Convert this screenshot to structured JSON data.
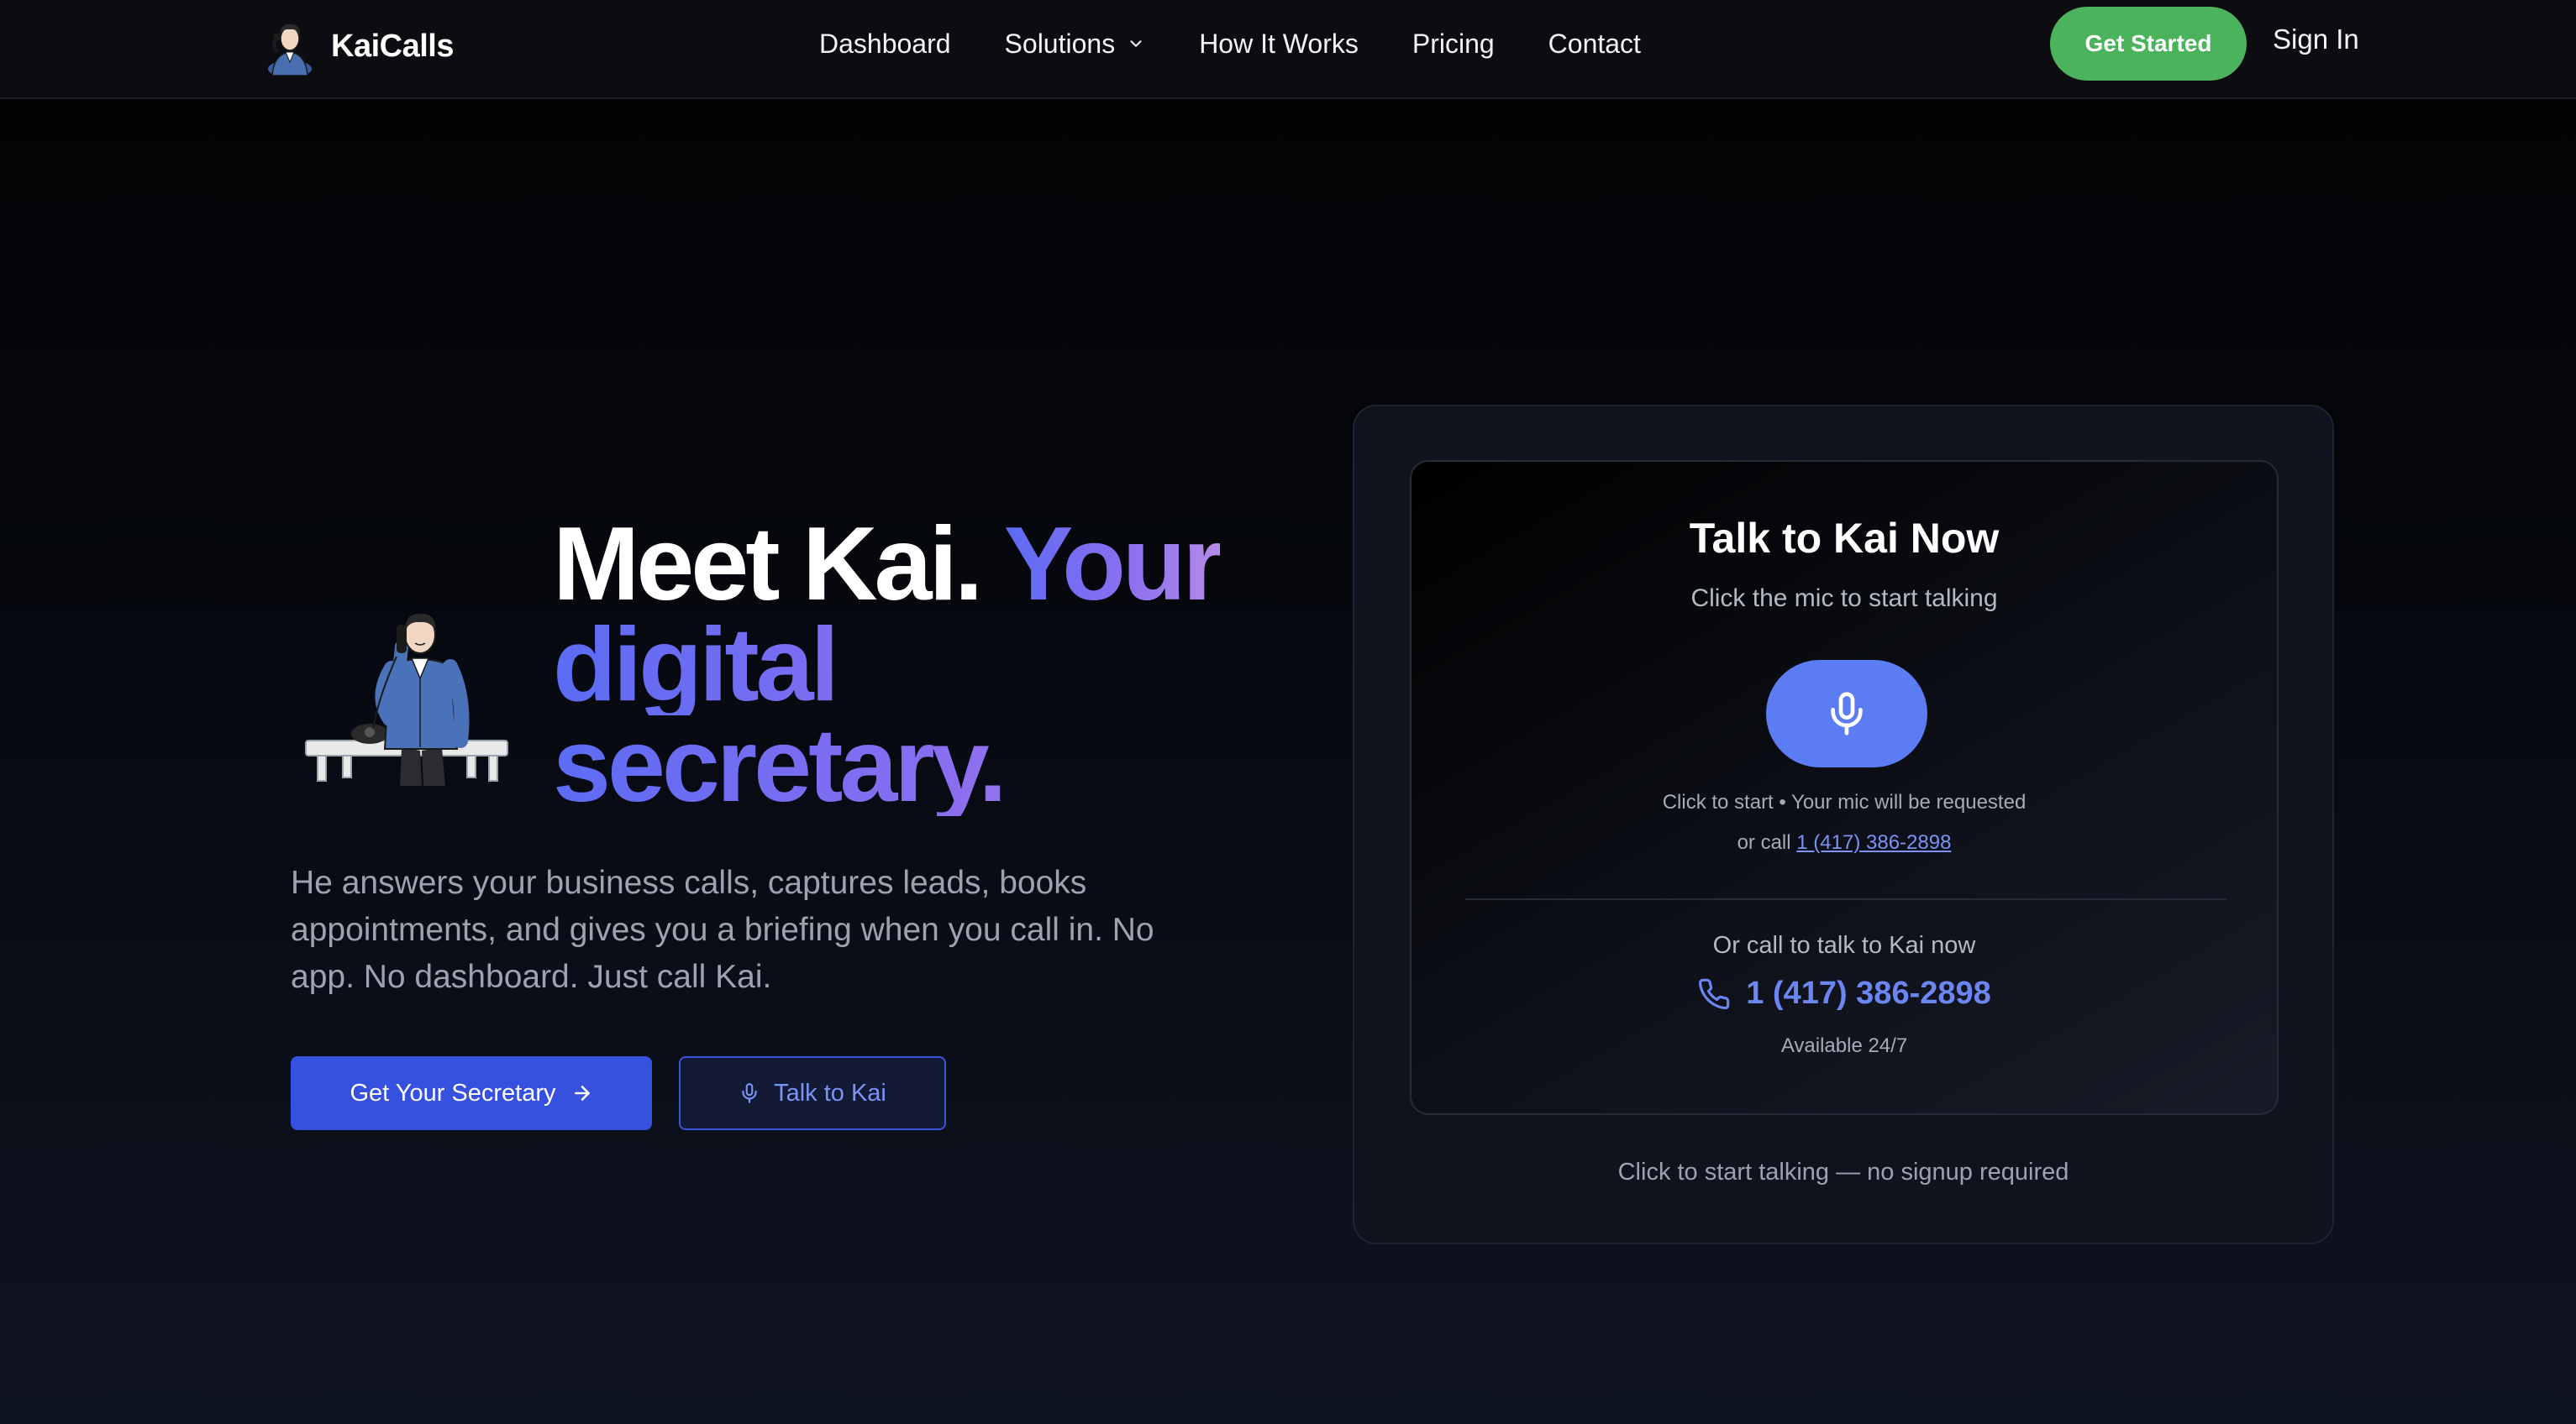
{
  "nav": {
    "brand": "KaiCalls",
    "links": [
      "Dashboard",
      "Solutions",
      "How It Works",
      "Pricing",
      "Contact"
    ],
    "cta": "Get Started",
    "sign_in": "Sign In"
  },
  "hero": {
    "headline_white": "Meet Kai.",
    "headline_accent_1": "Your",
    "headline_accent_2": "digital",
    "headline_accent_3": "secretary.",
    "subtitle": "He answers your business calls, captures leads, books appointments, and gives you a briefing when you call in. No app. No dashboard. Just call Kai.",
    "primary_button": "Get Your Secretary",
    "secondary_button": "Talk to Kai"
  },
  "talk_card": {
    "title": "Talk to Kai Now",
    "subtitle": "Click the mic to start talking",
    "mic_hint": "Click to start • Your mic will be requested",
    "or_call_prefix": "or call",
    "or_call_number": "1 (417) 386-2898",
    "call_label": "Or call to talk to Kai now",
    "phone_number": "1 (417) 386-2898",
    "availability": "Available 24/7",
    "footer_note": "Click to start talking — no signup required"
  },
  "colors": {
    "accent_blue": "#5b7cf2",
    "primary_button": "#3650e0",
    "cta_green": "#4bb35b",
    "gradient_start": "#5b6cf4",
    "gradient_end": "#b58be9"
  },
  "icons": [
    "chevron-down-icon",
    "arrow-right-icon",
    "microphone-icon",
    "phone-icon"
  ]
}
